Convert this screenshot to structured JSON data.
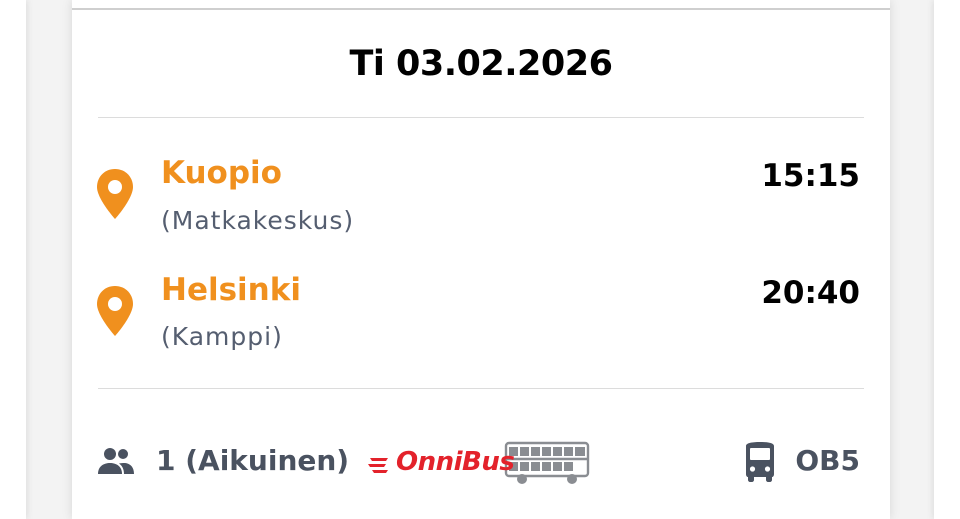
{
  "ticket": {
    "date": "Ti 03.02.2026",
    "departure": {
      "city": "Kuopio",
      "station": "(Matkakeskus)",
      "time": "15:15"
    },
    "arrival": {
      "city": "Helsinki",
      "station": "(Kamppi)",
      "time": "20:40"
    },
    "passengers": "1 (Aikuinen)",
    "operator": "OnniBus",
    "route_code": "OB5"
  },
  "colors": {
    "accent": "#f0901e",
    "brand_red": "#e3222b",
    "muted_text": "#555e70",
    "icon_gray": "#4a5260"
  },
  "icons": {
    "departure": "location-pin-icon",
    "arrival": "location-pin-icon",
    "passengers": "people-icon",
    "bus": "bus-icon"
  }
}
